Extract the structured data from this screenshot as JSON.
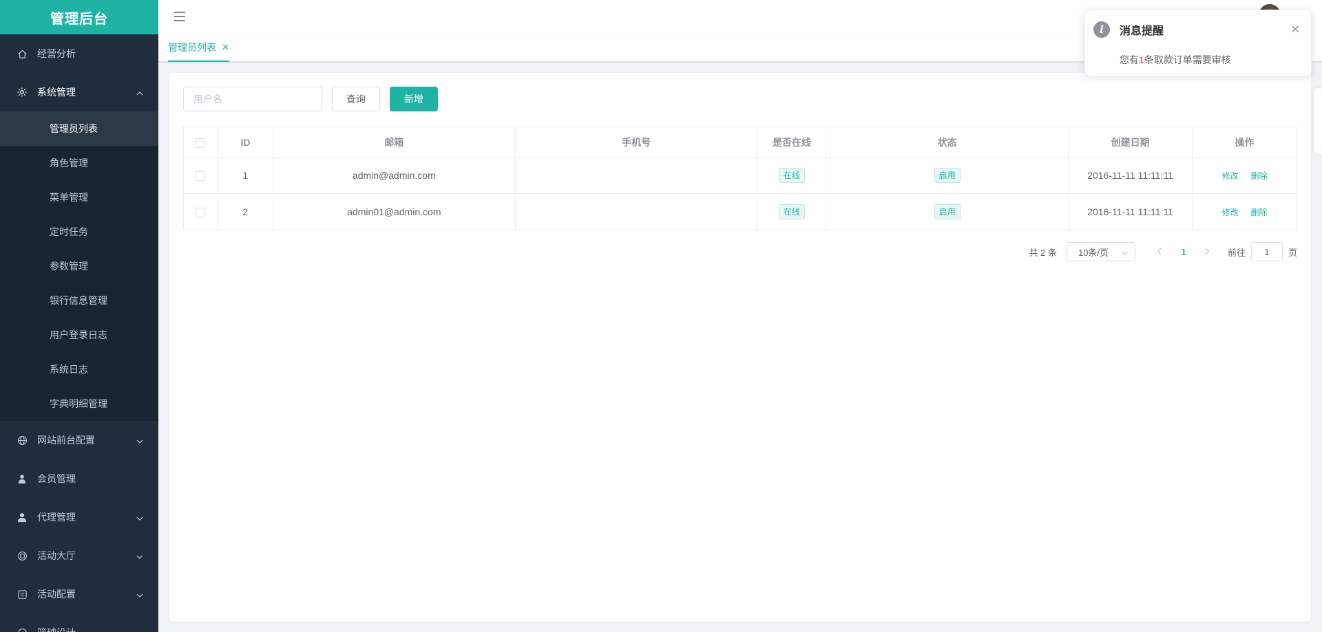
{
  "sidebar": {
    "logo": "管理后台",
    "items": [
      {
        "label": "经营分析",
        "icon": "home-icon"
      },
      {
        "label": "系统管理",
        "icon": "gear-icon",
        "open": true,
        "children": [
          {
            "label": "管理员列表",
            "active": true
          },
          {
            "label": "角色管理"
          },
          {
            "label": "菜单管理"
          },
          {
            "label": "定时任务"
          },
          {
            "label": "参数管理"
          },
          {
            "label": "银行信息管理"
          },
          {
            "label": "用户登录日志"
          },
          {
            "label": "系统日志"
          },
          {
            "label": "字典明细管理"
          }
        ]
      },
      {
        "label": "网站前台配置",
        "icon": "globe-icon"
      },
      {
        "label": "会员管理",
        "icon": "member-icon"
      },
      {
        "label": "代理管理",
        "icon": "user-icon"
      },
      {
        "label": "活动大厅",
        "icon": "activity-icon"
      },
      {
        "label": "活动配置",
        "icon": "config-icon"
      },
      {
        "label": "篮球设计",
        "icon": "ball-icon"
      }
    ]
  },
  "tags": {
    "active_tag": "管理员列表"
  },
  "toolbar": {
    "search_placeholder": "用户名",
    "query_label": "查询",
    "add_label": "新增"
  },
  "table": {
    "headers": [
      "ID",
      "邮箱",
      "手机号",
      "是否在线",
      "状态",
      "创建日期",
      "操作"
    ],
    "rows": [
      {
        "id": "1",
        "email": "admin@admin.com",
        "phone": "",
        "online": "在线",
        "status": "启用",
        "created": "2016-11-11 11:11:11",
        "edit": "修改",
        "delete": "删除"
      },
      {
        "id": "2",
        "email": "admin01@admin.com",
        "phone": "",
        "online": "在线",
        "status": "启用",
        "created": "2016-11-11 11:11:11",
        "edit": "修改",
        "delete": "删除"
      }
    ]
  },
  "pagination": {
    "total_text": "共 2 条",
    "page_size": "10条/页",
    "current_page": "1",
    "goto_prefix": "前往",
    "goto_value": "1",
    "goto_suffix": "页"
  },
  "notification": {
    "title": "消息提醒",
    "body_prefix": "您有",
    "body_count": "1",
    "body_suffix": "条取款订单需要审核"
  },
  "colors": {
    "accent": "#20b2a5",
    "sidebar_bg": "#1f2d3d",
    "danger": "#f56c6c"
  }
}
